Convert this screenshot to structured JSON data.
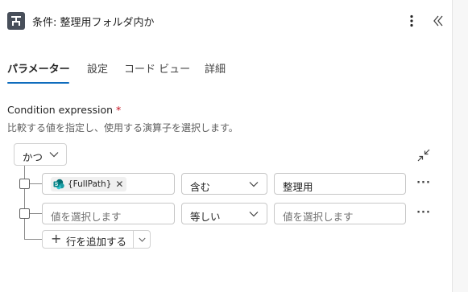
{
  "header": {
    "title": "条件: 整理用フォルダ内か",
    "more_icon": "more-vertical-icon",
    "collapse_icon": "chevron-double-left-icon"
  },
  "tabs": [
    {
      "label": "パラメーター",
      "active": true
    },
    {
      "label": "設定",
      "active": false
    },
    {
      "label": "コード ビュー",
      "active": false
    },
    {
      "label": "詳細",
      "active": false
    }
  ],
  "condition": {
    "label": "Condition expression",
    "required_mark": "*",
    "description": "比較する値を指定し、使用する演算子を選択します。",
    "group_operator": "かつ",
    "rows": [
      {
        "left_token": "{FullPath}",
        "left_token_icon": "sharepoint-icon",
        "operator": "含む",
        "right_value": "整理用",
        "left_placeholder": "",
        "right_placeholder": ""
      },
      {
        "left_token": "",
        "operator": "等しい",
        "right_value": "",
        "left_placeholder": "値を選択します",
        "right_placeholder": "値を選択します"
      }
    ],
    "add_row_label": "行を追加する",
    "row_more": "···",
    "token_remove": "✕",
    "add_icon": "+"
  },
  "colors": {
    "accent": "#0f6cbd",
    "required": "#c50f1f",
    "header_icon_bg": "#484f5a",
    "sharepoint_teal": "#038387"
  }
}
